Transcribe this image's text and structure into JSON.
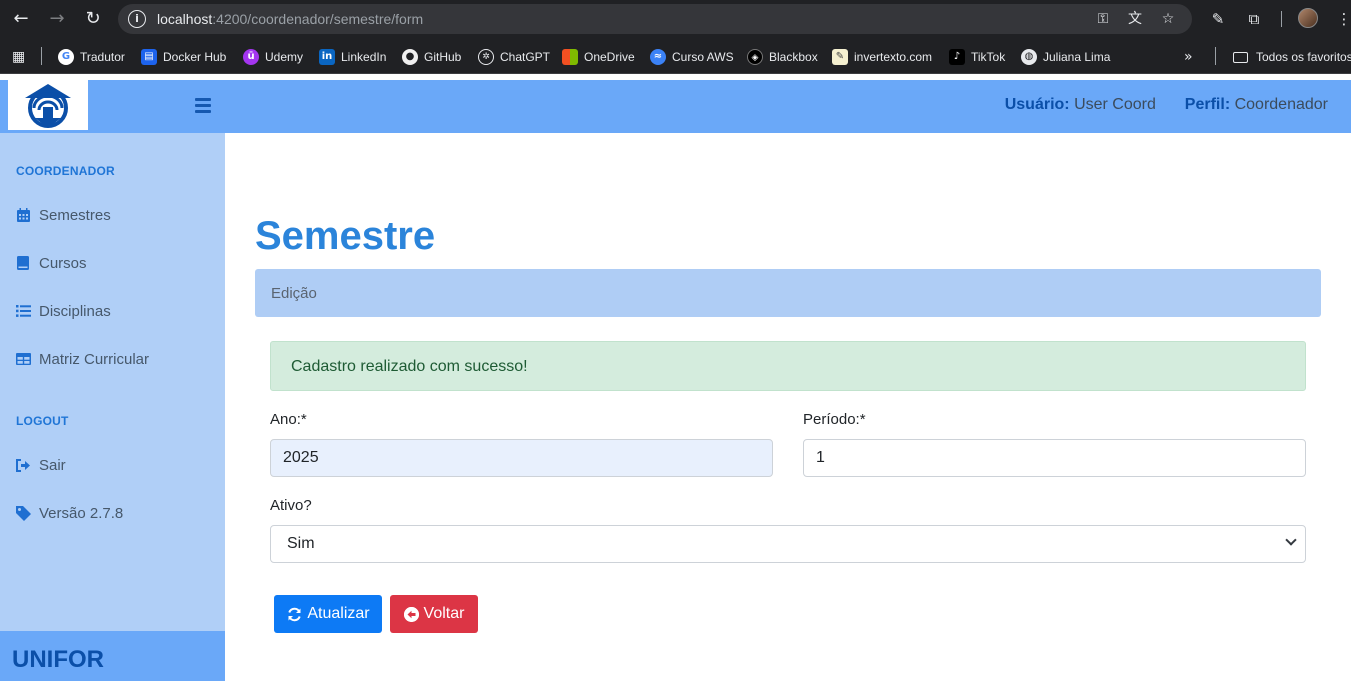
{
  "browser": {
    "url_host": "localhost",
    "url_path": ":4200/coordenador/semestre/form",
    "bookmarks": [
      {
        "label": "Tradutor",
        "icon": "google-icon",
        "color": "#4285f4"
      },
      {
        "label": "Docker Hub",
        "icon": "docker-icon",
        "color": "#1d63ed"
      },
      {
        "label": "Udemy",
        "icon": "udemy-icon",
        "color": "#a435f0"
      },
      {
        "label": "LinkedIn",
        "icon": "linkedin-icon",
        "color": "#0a66c2"
      },
      {
        "label": "GitHub",
        "icon": "github-icon",
        "color": "#f0f0f0"
      },
      {
        "label": "ChatGPT",
        "icon": "chatgpt-icon",
        "color": "#202124"
      },
      {
        "label": "OneDrive",
        "icon": "microsoft-icon",
        "color": "#f25022"
      },
      {
        "label": "Curso AWS",
        "icon": "aws-icon",
        "color": "#3b82f6"
      },
      {
        "label": "Blackbox",
        "icon": "blackbox-icon",
        "color": "#000000"
      },
      {
        "label": "invertexto.com",
        "icon": "invertexto-icon",
        "color": "#f5c542"
      },
      {
        "label": "TikTok",
        "icon": "tiktok-icon",
        "color": "#000000"
      },
      {
        "label": "Juliana Lima",
        "icon": "globe-icon",
        "color": "#e8eaed"
      }
    ],
    "all_bookmarks_label": "Todos os favoritos"
  },
  "header": {
    "user_label": "Usuário:",
    "user_value": "User Coord",
    "profile_label": "Perfil:",
    "profile_value": "Coordenador"
  },
  "sidebar": {
    "section_coordinator": "COORDENADOR",
    "items": [
      {
        "label": "Semestres",
        "icon": "calendar-icon"
      },
      {
        "label": "Cursos",
        "icon": "book-icon"
      },
      {
        "label": "Disciplinas",
        "icon": "list-icon"
      },
      {
        "label": "Matriz Curricular",
        "icon": "table-icon"
      }
    ],
    "section_logout": "LOGOUT",
    "logout_items": [
      {
        "label": "Sair",
        "icon": "sign-out-icon"
      },
      {
        "label": "Versão 2.7.8",
        "icon": "tag-icon"
      }
    ],
    "footer": "UNIFOR"
  },
  "main": {
    "title": "Semestre",
    "card_header": "Edição",
    "alert": "Cadastro realizado com sucesso!",
    "fields": {
      "ano_label": "Ano:*",
      "ano_value": "2025",
      "periodo_label": "Período:*",
      "periodo_value": "1",
      "ativo_label": "Ativo?",
      "ativo_value": "Sim"
    },
    "buttons": {
      "update": "Atualizar",
      "back": "Voltar"
    }
  },
  "colors": {
    "header_bg": "#6aa8f8",
    "sidebar_bg": "#b0cff7",
    "title": "#2b84da",
    "primary": "#0d7af5",
    "danger": "#dc3545",
    "success_bg": "#d4ecdd"
  }
}
